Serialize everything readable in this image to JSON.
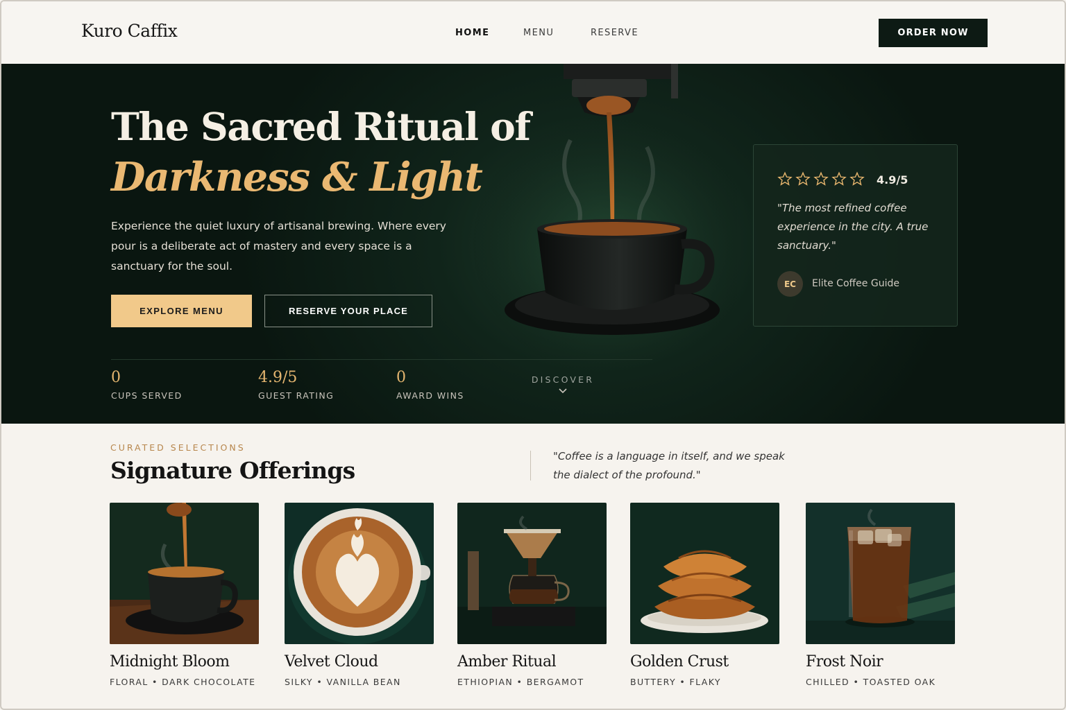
{
  "nav": {
    "brand": "Kuro Caffix",
    "links": [
      {
        "label": "HOME",
        "active": true
      },
      {
        "label": "MENU",
        "active": false
      },
      {
        "label": "RESERVE",
        "active": false
      }
    ],
    "order_label": "ORDER NOW"
  },
  "hero": {
    "title_line1": "The Sacred Ritual of",
    "title_line2": "Darkness & Light",
    "description": "Experience the quiet luxury of artisanal brewing. Where every pour is a deliberate act of mastery and every space is a sanctuary for the soul.",
    "explore_label": "EXPLORE MENU",
    "reserve_label": "RESERVE YOUR PLACE",
    "stats": [
      {
        "value": "0",
        "label": "CUPS SERVED"
      },
      {
        "value": "4.9/5",
        "label": "GUEST RATING"
      },
      {
        "value": "0",
        "label": "AWARD WINS"
      }
    ],
    "discover_label": "DISCOVER",
    "colors": {
      "accent": "#eab872",
      "background": "#0f2118"
    }
  },
  "review": {
    "star_count": 5,
    "rating": "4.9/5",
    "quote": "\"The most refined coffee experience in the city. A true sanctuary.\"",
    "avatar_initials": "EC",
    "reviewer": "Elite Coffee Guide"
  },
  "offerings": {
    "eyebrow": "CURATED SELECTIONS",
    "title": "Signature Offerings",
    "quote": "\"Coffee is a language in itself, and we speak the dialect of the profound.\"",
    "items": [
      {
        "name": "Midnight Bloom",
        "notes": "FLORAL • DARK CHOCOLATE",
        "icon": "espresso-pour-icon"
      },
      {
        "name": "Velvet Cloud",
        "notes": "SILKY • VANILLA BEAN",
        "icon": "latte-art-icon"
      },
      {
        "name": "Amber Ritual",
        "notes": "ETHIOPIAN • BERGAMOT",
        "icon": "pour-over-icon"
      },
      {
        "name": "Golden Crust",
        "notes": "BUTTERY • FLAKY",
        "icon": "croissant-icon"
      },
      {
        "name": "Frost Noir",
        "notes": "CHILLED • TOASTED OAK",
        "icon": "iced-coffee-icon"
      }
    ]
  }
}
